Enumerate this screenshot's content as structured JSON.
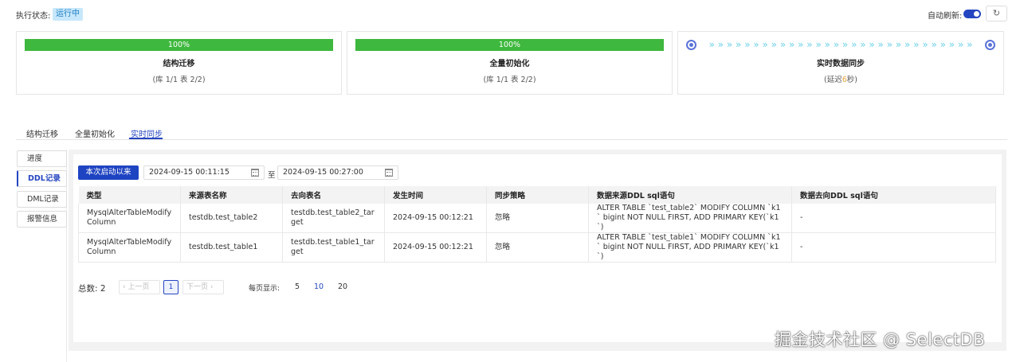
{
  "header": {
    "status_label": "执行状态:",
    "status_value": "运行中",
    "auto_refresh_label": "自动刷新:",
    "auto_refresh_on": true,
    "refresh_icon": "↻"
  },
  "cards": {
    "schema": {
      "progress_text": "100%",
      "progress": 1.0,
      "title": "结构迁移",
      "sub": "(库 1/1 表 2/2)"
    },
    "full": {
      "progress_text": "100%",
      "progress": 1.0,
      "title": "全量初始化",
      "sub": "(库 1/1 表 2/2)"
    },
    "realtime": {
      "title": "实时数据同步",
      "sub_prefix": "(延迟",
      "lag": "6",
      "sub_suffix": "秒)",
      "arrows": "» » » » » » » » » » » » » » » » » » » » » » » » » » » » » »"
    }
  },
  "tabs": [
    "结构迁移",
    "全量初始化",
    "实时同步"
  ],
  "sidenav": [
    "进度",
    "DDL记录",
    "DML记录",
    "报警信息"
  ],
  "filter": {
    "since_button": "本次启动以来",
    "start_date": "2024-09-15 00:11:15",
    "to": "至",
    "end_date": "2024-09-15 00:27:00"
  },
  "table": {
    "columns": [
      "类型",
      "来源表名称",
      "去向表名",
      "发生时间",
      "同步策略",
      "数据来源DDL sql语句",
      "数据去向DDL sql语句"
    ],
    "rows": [
      [
        "MysqlAlterTableModifyColumn",
        "testdb.test_table2",
        "testdb.test_table2_target",
        "2024-09-15 00:12:21",
        "忽略",
        "ALTER TABLE `test_table2` MODIFY COLUMN `k1` bigint NOT NULL FIRST, ADD PRIMARY KEY(`k1`)",
        "-"
      ],
      [
        "MysqlAlterTableModifyColumn",
        "testdb.test_table1",
        "testdb.test_table1_target",
        "2024-09-15 00:12:21",
        "忽略",
        "ALTER TABLE `test_table1` MODIFY COLUMN `k1` bigint NOT NULL FIRST, ADD PRIMARY KEY(`k1`)",
        "-"
      ]
    ]
  },
  "pager": {
    "total_label": "总数: 2",
    "prev": "‹ 上一页",
    "current": "1",
    "next": "下一页 ›",
    "per_page_label": "每页显示:",
    "sizes": [
      "5",
      "10",
      "20"
    ]
  },
  "watermark": "掘金技术社区 @ SelectDB",
  "colors": {
    "accent": "#2545c0",
    "progress": "#3eb83e",
    "lag": "#e8a23a"
  }
}
